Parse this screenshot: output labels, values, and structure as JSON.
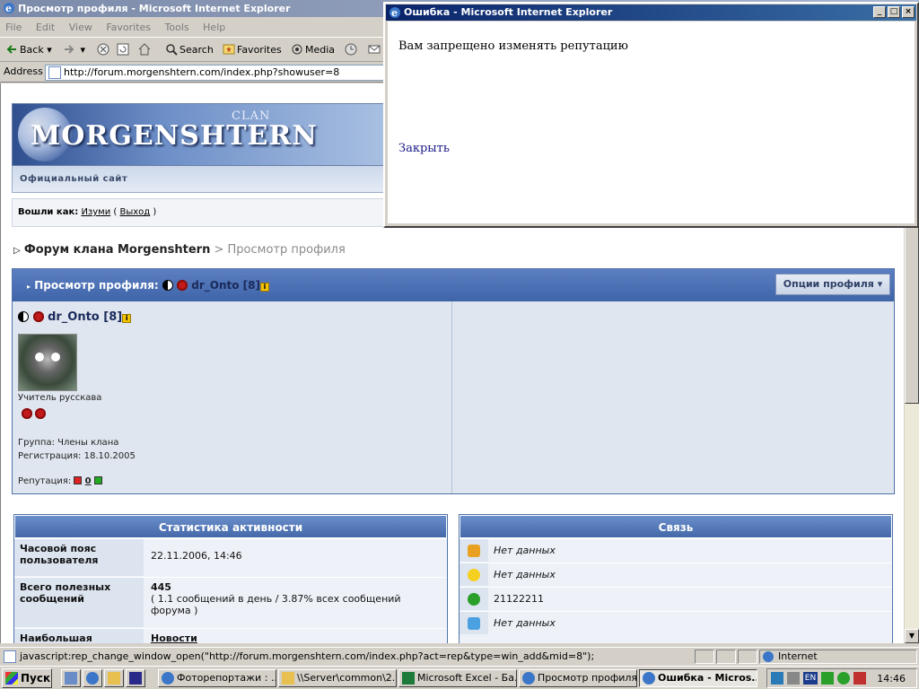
{
  "main_window": {
    "title": "Просмотр профиля - Microsoft Internet Explorer",
    "menu": [
      "File",
      "Edit",
      "View",
      "Favorites",
      "Tools",
      "Help"
    ],
    "toolbar": {
      "back": "Back",
      "search": "Search",
      "favorites": "Favorites",
      "media": "Media"
    },
    "address_label": "Address",
    "address_value": "http://forum.morgenshtern.com/index.php?showuser=8"
  },
  "site": {
    "clan": "CLAN",
    "logo": "MORGENSHTERN",
    "subtitle": "Официальный сайт",
    "login_prefix": "Вошли как:",
    "login_user": "Изуми",
    "logout": "Выход"
  },
  "breadcrumb": {
    "forum": "Форум клана Morgenshtern",
    "sep": ">",
    "current": "Просмотр профиля"
  },
  "profile": {
    "header_prefix": "Просмотр профиля:",
    "username": "dr_Onto [8]",
    "options_button": "Опции профиля ▾",
    "user_title": "Учитель русскава",
    "group": "Группа: Члены клана",
    "registered": "Регистрация: 18.10.2005",
    "reputation_label": "Репутация:",
    "reputation_value": "0"
  },
  "stats": {
    "title": "Статистика активности",
    "rows": [
      {
        "key": "Часовой пояс пользователя",
        "value": "22.11.2006, 14:46",
        "value2": ""
      },
      {
        "key": "Всего полезных сообщений",
        "value": "445",
        "value2": "( 1.1 сообщений в день / 3.87% всех сообщений форума )"
      },
      {
        "key": "Наибольшая",
        "value": "Новости",
        "value2": ""
      }
    ]
  },
  "contact": {
    "title": "Связь",
    "rows": [
      {
        "icon": "aim-icon",
        "value": "Нет данных"
      },
      {
        "icon": "yahoo-icon",
        "value": "Нет данных"
      },
      {
        "icon": "icq-icon",
        "value": "21122211"
      },
      {
        "icon": "msn-icon",
        "value": "Нет данных"
      }
    ]
  },
  "statusbar": {
    "text": "javascript:rep_change_window_open(\"http://forum.morgenshtern.com/index.php?act=rep&type=win_add&mid=8\");",
    "zone": "Internet"
  },
  "taskbar": {
    "start": "Пуск",
    "items": [
      "Фоторепортажи : ...",
      "\\\\Server\\common\\2...",
      "Microsoft Excel - Ба...",
      "Просмотр профиля...",
      "Ошибка - Micros..."
    ],
    "lang": "EN",
    "clock": "14:46"
  },
  "popup": {
    "title": "Ошибка - Microsoft Internet Explorer",
    "message": "Вам запрещено изменять репутацию",
    "close": "Закрыть"
  }
}
